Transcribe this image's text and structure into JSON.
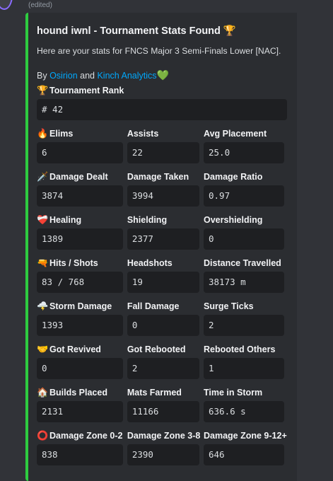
{
  "message": {
    "edited_label": "(edited)"
  },
  "embed": {
    "accent_color": "#2ecc40",
    "title": "hound iwnl - Tournament Stats Found 🏆",
    "description": "Here are your stats for FNCS Major 3 Semi-Finals Lower [NAC].",
    "credits": {
      "prefix": "By ",
      "link1": "Osirion",
      "middle": " and ",
      "link2": "Kinch Analytics",
      "heart": "💚"
    },
    "rank": {
      "emoji": "🏆",
      "label": "Tournament Rank",
      "value": "# 42"
    },
    "rows": [
      {
        "fields": [
          {
            "emoji": "🔥",
            "label": "Elims",
            "value": "6"
          },
          {
            "label": "Assists",
            "value": "22"
          },
          {
            "label": "Avg Placement",
            "value": "25.0"
          }
        ]
      },
      {
        "fields": [
          {
            "emoji": "🗡️",
            "label": "Damage Dealt",
            "value": "3874"
          },
          {
            "label": "Damage Taken",
            "value": "3994"
          },
          {
            "label": "Damage Ratio",
            "value": "0.97"
          }
        ]
      },
      {
        "fields": [
          {
            "emoji": "❤️‍🩹",
            "label": "Healing",
            "value": "1389"
          },
          {
            "label": "Shielding",
            "value": "2377"
          },
          {
            "label": "Overshielding",
            "value": "0"
          }
        ]
      },
      {
        "fields": [
          {
            "emoji": "🔫",
            "label": "Hits / Shots",
            "value": "83 / 768"
          },
          {
            "label": "Headshots",
            "value": "19"
          },
          {
            "label": "Distance Travelled",
            "value": "38173 m"
          }
        ]
      },
      {
        "fields": [
          {
            "emoji": "🌩️",
            "label": "Storm Damage",
            "value": "1393"
          },
          {
            "label": "Fall Damage",
            "value": "0"
          },
          {
            "label": "Surge Ticks",
            "value": "2"
          }
        ]
      },
      {
        "fields": [
          {
            "emoji": "🤝",
            "label": "Got Revived",
            "value": "0"
          },
          {
            "label": "Got Rebooted",
            "value": "2"
          },
          {
            "label": "Rebooted Others",
            "value": "1"
          }
        ]
      },
      {
        "fields": [
          {
            "emoji": "🏠",
            "label": "Builds Placed",
            "value": "2131"
          },
          {
            "label": "Mats Farmed",
            "value": "11166"
          },
          {
            "label": "Time in Storm",
            "value": "636.6 s"
          }
        ]
      },
      {
        "fields": [
          {
            "emoji": "⭕",
            "label": "Damage Zone 0-2",
            "value": "838"
          },
          {
            "label": "Damage Zone 3-8",
            "value": "2390"
          },
          {
            "label": "Damage Zone 9-12+",
            "value": "646"
          }
        ]
      }
    ]
  }
}
